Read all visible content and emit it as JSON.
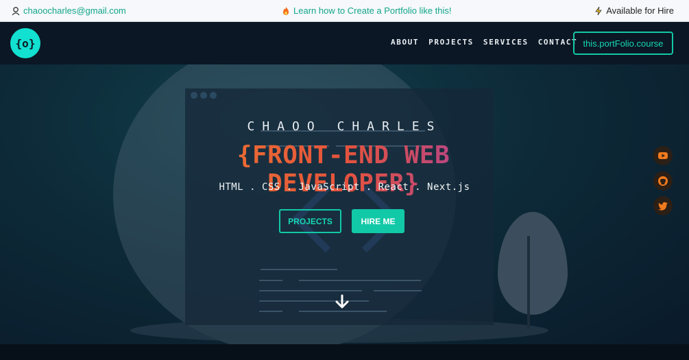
{
  "topbar": {
    "email": "chaoocharles@gmail.com",
    "promo": "Learn how to Create a Portfolio like this!",
    "availability": "Available for Hire"
  },
  "nav": {
    "logo": "{o}",
    "links": [
      "ABOUT",
      "PROJECTS",
      "SERVICES",
      "CONTACT"
    ],
    "course_button": "this.portFolio.course"
  },
  "hero": {
    "name": "CHAOO CHARLES",
    "role": "{FRONT-END WEB DEVELOPER}",
    "stack": "HTML . CSS . JavaScript . React . Next.js",
    "projects_button": "PROJECTS",
    "hire_button": "HIRE ME"
  },
  "social": [
    {
      "icon": "youtube-icon"
    },
    {
      "icon": "github-icon"
    },
    {
      "icon": "twitter-icon"
    }
  ],
  "colors": {
    "accent": "#12c9a7",
    "icon_orange": "#f07a1d",
    "role_start": "#ef7a2e",
    "role_end": "#a13fa8"
  }
}
